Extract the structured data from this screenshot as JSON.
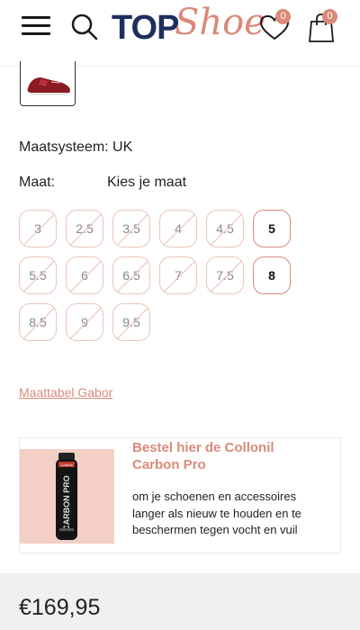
{
  "header": {
    "logo_top": "TOP",
    "logo_shoe": "Shoe",
    "wishlist_count": "0",
    "cart_count": "0"
  },
  "product": {
    "size_system_label": "Maatsysteem: UK",
    "size_label": "Maat:",
    "size_choose": "Kies je maat",
    "sizes": [
      {
        "label": "3",
        "available": false
      },
      {
        "label": "2.5",
        "available": false
      },
      {
        "label": "3.5",
        "available": false
      },
      {
        "label": "4",
        "available": false
      },
      {
        "label": "4.5",
        "available": false
      },
      {
        "label": "5",
        "available": true
      },
      {
        "label": "5.5",
        "available": false
      },
      {
        "label": "6",
        "available": false
      },
      {
        "label": "6.5",
        "available": false
      },
      {
        "label": "7",
        "available": false
      },
      {
        "label": "7.5",
        "available": false
      },
      {
        "label": "8",
        "available": true
      },
      {
        "label": "8.5",
        "available": false
      },
      {
        "label": "9",
        "available": false
      },
      {
        "label": "9.5",
        "available": false
      }
    ],
    "size_chart_link": "Maattabel Gabor",
    "price": "€169,95"
  },
  "promo": {
    "title": "Bestel hier de Collonil Carbon Pro",
    "text": "om je schoenen en accessoires langer als nieuw te houden en te beschermen tegen vocht en vuil",
    "image_brand": "Collonil",
    "image_product": "CARBON PRO"
  },
  "colors": {
    "accent": "#d98a78",
    "navy": "#1e2f5c"
  }
}
